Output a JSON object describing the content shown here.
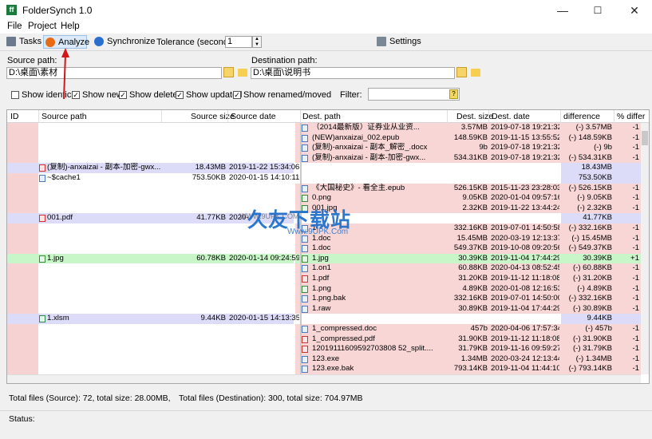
{
  "window": {
    "title": "FolderSynch 1.0",
    "app_icon": "ff",
    "controls": [
      "—",
      "☐",
      "✕"
    ]
  },
  "menu": [
    "File",
    "Project",
    "Help"
  ],
  "toolbar": {
    "tasks": "Tasks",
    "analyze": "Analyze",
    "synchronize": "Synchronize",
    "tolerance_label": "Tolerance (seconds):",
    "tolerance_value": "1",
    "settings": "Settings",
    "analyze_color": "#e86a12",
    "synchronize_color": "#2a6fce"
  },
  "source": {
    "label": "Source path:",
    "value": "D:\\桌面\\素材"
  },
  "destination": {
    "label": "Destination path:",
    "value": "D:\\桌面\\说明书"
  },
  "filters": [
    {
      "label": "Show identical",
      "checked": false
    },
    {
      "label": "Show new",
      "checked": true
    },
    {
      "label": "Show deleted",
      "checked": true
    },
    {
      "label": "Show updated",
      "checked": true
    },
    {
      "label": "Show renamed/moved",
      "checked": true
    }
  ],
  "filter_label": "Filter:",
  "filter_value": "",
  "columns": {
    "id": "ID",
    "src_path": "Source path",
    "src_size": "Source size",
    "src_date": "Source date",
    "dst_path": "Dest. path",
    "dst_size": "Dest. size",
    "dst_date": "Dest. date",
    "diff": "difference",
    "pct": "% differ"
  },
  "rows": [
    {
      "id": "",
      "src": "",
      "ssize": "",
      "sdate": "",
      "dst": "（2014最新版）证券业从业资...",
      "dsize": "3.57MB",
      "ddate": "2019-07-18 19:21:32",
      "diff": "(-) 3.57MB",
      "pct": "-1",
      "kind": "deleted",
      "icon": "doc"
    },
    {
      "id": "",
      "src": "",
      "ssize": "",
      "sdate": "",
      "dst": "(NEW)anxaizai_002.epub",
      "dsize": "148.59KB",
      "ddate": "2019-11-15 13:55:52",
      "diff": "(-) 148.59KB",
      "pct": "-1",
      "kind": "deleted",
      "icon": "doc"
    },
    {
      "id": "",
      "src": "",
      "ssize": "",
      "sdate": "",
      "dst": "(复制)-anxaizai - 副本_解密_.docx",
      "dsize": "9b",
      "ddate": "2019-07-18 19:21:32",
      "diff": "(-) 9b",
      "pct": "-1",
      "kind": "deleted",
      "icon": "doc"
    },
    {
      "id": "",
      "src": "",
      "ssize": "",
      "sdate": "",
      "dst": "(复制)-anxaizai - 副本-加密-gwx...",
      "dsize": "534.31KB",
      "ddate": "2019-07-18 19:21:32",
      "diff": "(-) 534.31KB",
      "pct": "-1",
      "kind": "deleted",
      "icon": "doc"
    },
    {
      "id": "",
      "src": "(复制)-anxaizai - 副本-加密-gwx...",
      "ssize": "18.43MB",
      "sdate": "2019-11-22 15:34:06",
      "dst": "",
      "dsize": "",
      "ddate": "",
      "diff": "18.43MB",
      "pct": "",
      "kind": "new",
      "icon": "pdf"
    },
    {
      "id": "",
      "src": "~$cache1",
      "ssize": "753.50KB",
      "sdate": "2020-01-15 14:10:11",
      "dst": "",
      "dsize": "",
      "ddate": "",
      "diff": "753.50KB",
      "pct": "",
      "kind": "plain",
      "icon": "doc"
    },
    {
      "id": "",
      "src": "",
      "ssize": "",
      "sdate": "",
      "dst": "《大国秘史》- 看全主.epub",
      "dsize": "526.15KB",
      "ddate": "2015-11-23 23:28:03",
      "diff": "(-) 526.15KB",
      "pct": "-1",
      "kind": "deleted",
      "icon": "doc"
    },
    {
      "id": "",
      "src": "",
      "ssize": "",
      "sdate": "",
      "dst": "0.png",
      "dsize": "9.05KB",
      "ddate": "2020-01-04 09:57:16",
      "diff": "(-) 9.05KB",
      "pct": "-1",
      "kind": "deleted",
      "icon": "img"
    },
    {
      "id": "",
      "src": "",
      "ssize": "",
      "sdate": "",
      "dst": "001.jpg",
      "dsize": "2.32KB",
      "ddate": "2019-11-22 13:44:24",
      "diff": "(-) 2.32KB",
      "pct": "-1",
      "kind": "deleted",
      "icon": "img"
    },
    {
      "id": "",
      "src": "001.pdf",
      "ssize": "41.77KB",
      "sdate": "2020-",
      "dst": "",
      "dsize": "",
      "ddate": "",
      "diff": "41.77KB",
      "pct": "",
      "kind": "new",
      "icon": "pdf"
    },
    {
      "id": "",
      "src": "",
      "ssize": "",
      "sdate": "",
      "dst": "1",
      "dsize": "332.16KB",
      "ddate": "2019-07-01 14:50:58",
      "diff": "(-) 332.16KB",
      "pct": "-1",
      "kind": "deleted",
      "icon": "doc"
    },
    {
      "id": "",
      "src": "",
      "ssize": "",
      "sdate": "",
      "dst": "1.doc",
      "dsize": "15.45MB",
      "ddate": "2020-03-19 12:13:37",
      "diff": "(-) 15.45MB",
      "pct": "-1",
      "kind": "deleted",
      "icon": "doc"
    },
    {
      "id": "",
      "src": "",
      "ssize": "",
      "sdate": "",
      "dst": "1.doc",
      "dsize": "549.37KB",
      "ddate": "2019-10-08 09:20:56",
      "diff": "(-) 549.37KB",
      "pct": "-1",
      "kind": "deleted",
      "icon": "doc"
    },
    {
      "id": "",
      "src": "1.jpg",
      "ssize": "60.78KB",
      "sdate": "2020-01-14 09:24:59",
      "dst": "1.jpg",
      "dsize": "30.39KB",
      "ddate": "2019-11-04 17:44:29",
      "diff": "30.39KB",
      "pct": "+1",
      "kind": "updated",
      "icon": "img"
    },
    {
      "id": "",
      "src": "",
      "ssize": "",
      "sdate": "",
      "dst": "1.on1",
      "dsize": "60.88KB",
      "ddate": "2020-04-13 08:52:45",
      "diff": "(-) 60.88KB",
      "pct": "-1",
      "kind": "deleted",
      "icon": "doc"
    },
    {
      "id": "",
      "src": "",
      "ssize": "",
      "sdate": "",
      "dst": "1.pdf",
      "dsize": "31.20KB",
      "ddate": "2019-11-12 11:18:08",
      "diff": "(-) 31.20KB",
      "pct": "-1",
      "kind": "deleted",
      "icon": "pdf"
    },
    {
      "id": "",
      "src": "",
      "ssize": "",
      "sdate": "",
      "dst": "1.png",
      "dsize": "4.89KB",
      "ddate": "2020-01-08 12:16:53",
      "diff": "(-) 4.89KB",
      "pct": "-1",
      "kind": "deleted",
      "icon": "img"
    },
    {
      "id": "",
      "src": "",
      "ssize": "",
      "sdate": "",
      "dst": "1.png.bak",
      "dsize": "332.16KB",
      "ddate": "2019-07-01 14:50:00",
      "diff": "(-) 332.16KB",
      "pct": "-1",
      "kind": "deleted",
      "icon": "doc"
    },
    {
      "id": "",
      "src": "",
      "ssize": "",
      "sdate": "",
      "dst": "1.raw",
      "dsize": "30.89KB",
      "ddate": "2019-11-04 17:44:29",
      "diff": "(-) 30.89KB",
      "pct": "-1",
      "kind": "deleted",
      "icon": "doc"
    },
    {
      "id": "",
      "src": "1.xlsm",
      "ssize": "9.44KB",
      "sdate": "2020-01-15 14:13:35",
      "dst": "",
      "dsize": "",
      "ddate": "",
      "diff": "9.44KB",
      "pct": "",
      "kind": "new",
      "icon": "xls"
    },
    {
      "id": "",
      "src": "",
      "ssize": "",
      "sdate": "",
      "dst": "1_compressed.doc",
      "dsize": "457b",
      "ddate": "2020-04-06 17:57:34",
      "diff": "(-) 457b",
      "pct": "-1",
      "kind": "deleted",
      "icon": "doc"
    },
    {
      "id": "",
      "src": "",
      "ssize": "",
      "sdate": "",
      "dst": "1_compressed.pdf",
      "dsize": "31.90KB",
      "ddate": "2019-11-12 11:18:08",
      "diff": "(-) 31.90KB",
      "pct": "-1",
      "kind": "deleted",
      "icon": "pdf"
    },
    {
      "id": "",
      "src": "",
      "ssize": "",
      "sdate": "",
      "dst": "12019111609592703808 52_split....",
      "dsize": "31.79KB",
      "ddate": "2019-11-16 09:59:27",
      "diff": "(-) 31.79KB",
      "pct": "-1",
      "kind": "deleted",
      "icon": "pdf"
    },
    {
      "id": "",
      "src": "",
      "ssize": "",
      "sdate": "",
      "dst": "123.exe",
      "dsize": "1.34MB",
      "ddate": "2020-03-24 12:13:44",
      "diff": "(-) 1.34MB",
      "pct": "-1",
      "kind": "deleted",
      "icon": "doc"
    },
    {
      "id": "",
      "src": "",
      "ssize": "",
      "sdate": "",
      "dst": "123.exe.bak",
      "dsize": "793.14KB",
      "ddate": "2019-11-04 11:44:10",
      "diff": "(-) 793.14KB",
      "pct": "-1",
      "kind": "deleted",
      "icon": "doc"
    }
  ],
  "colors": {
    "deleted": "#f8d6d6",
    "new": "#dcdcf8",
    "updated": "#c8f6c8",
    "plain": "#ffffff",
    "id_deleted": "#f6d2d2"
  },
  "summary": {
    "source": "Total files (Source): 72, total size: 28.00MB,",
    "destination": "Total files (Destination): 300, total size: 704.97MB"
  },
  "status": "Status:",
  "watermark": {
    "main": "久友下载站",
    "sub": "Www.9UPK.Com",
    "small": "WWW.9UPK.COM"
  }
}
